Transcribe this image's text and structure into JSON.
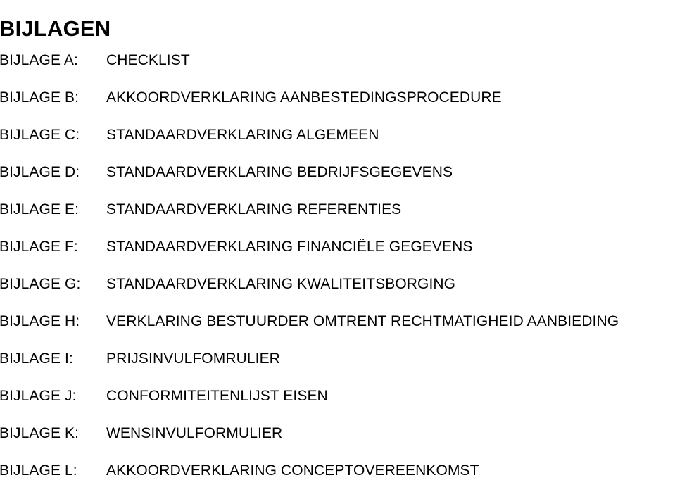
{
  "document": {
    "title": "BIJLAGEN",
    "annexes": [
      {
        "label": "BIJLAGE A:",
        "value": "CHECKLIST"
      },
      {
        "label": "BIJLAGE B:",
        "value": "AKKOORDVERKLARING AANBESTEDINGSPROCEDURE"
      },
      {
        "label": "BIJLAGE C:",
        "value": "STANDAARDVERKLARING ALGEMEEN"
      },
      {
        "label": "BIJLAGE D:",
        "value": "STANDAARDVERKLARING BEDRIJFSGEGEVENS"
      },
      {
        "label": "BIJLAGE E:",
        "value": "STANDAARDVERKLARING REFERENTIES"
      },
      {
        "label": "BIJLAGE F:",
        "value": "STANDAARDVERKLARING FINANCIËLE GEGEVENS"
      },
      {
        "label": "BIJLAGE G:",
        "value": "STANDAARDVERKLARING KWALITEITSBORGING"
      },
      {
        "label": "BIJLAGE H:",
        "value": "VERKLARING BESTUURDER OMTRENT RECHTMATIGHEID AANBIEDING"
      },
      {
        "label": "BIJLAGE I:",
        "value": "PRIJSINVULFOMRULIER"
      },
      {
        "label": "BIJLAGE J:",
        "value": "CONFORMITEITENLIJST EISEN"
      },
      {
        "label": "BIJLAGE K:",
        "value": "WENSINVULFORMULIER"
      },
      {
        "label": "BIJLAGE L:",
        "value": "AKKOORDVERKLARING CONCEPTOVEREENKOMST"
      }
    ]
  },
  "colors": {
    "text": "#000000",
    "background": "#ffffff"
  }
}
